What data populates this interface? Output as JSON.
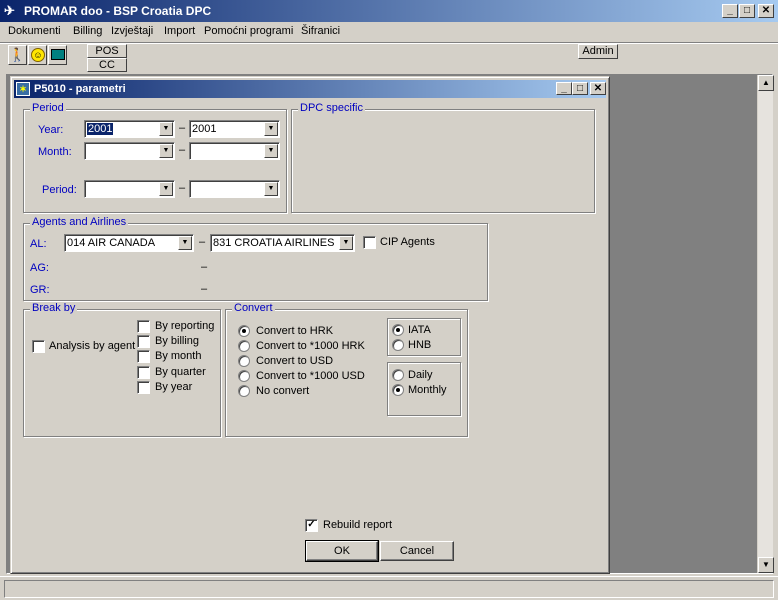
{
  "window": {
    "title": "PROMAR doo - BSP Croatia DPC"
  },
  "menu": [
    "Dokumenti",
    "Billing",
    "Izvještaji",
    "Import",
    "Pomoćni programi",
    "Šifranici"
  ],
  "toolbar": {
    "pos_label": "POS",
    "cc_label": "CC",
    "admin_label": "Admin"
  },
  "dialog": {
    "title": "P5010 - parametri",
    "period": {
      "label": "Period",
      "year_label": "Year:",
      "month_label": "Month:",
      "period_label": "Period:",
      "year_from": "2001",
      "year_to": "2001",
      "month_from": "",
      "month_to": "",
      "period_from": "",
      "period_to": ""
    },
    "dpc": {
      "label": "DPC specific"
    },
    "agents": {
      "label": "Agents and Airlines",
      "al_label": "AL:",
      "ag_label": "AG:",
      "gr_label": "GR:",
      "al_from": "014 AIR CANADA",
      "al_to": "831 CROATIA AIRLINES",
      "cip_label": "CIP Agents",
      "cip_checked": false
    },
    "breakby": {
      "label": "Break by",
      "analysis_label": "Analysis by agent",
      "options": [
        "By reporting",
        "By billing",
        "By month",
        "By quarter",
        "By year"
      ]
    },
    "convert": {
      "label": "Convert",
      "options": [
        "Convert to HRK",
        "Convert to *1000 HRK",
        "Convert to USD",
        "Convert to *1000 USD",
        "No convert"
      ],
      "selected": 0,
      "source_options": [
        "IATA",
        "HNB"
      ],
      "source_selected": 0,
      "freq_options": [
        "Daily",
        "Monthly"
      ],
      "freq_selected": 1
    },
    "rebuild_label": "Rebuild report",
    "rebuild_checked": true,
    "ok_label": "OK",
    "cancel_label": "Cancel"
  },
  "colors": {
    "title_active": "#0a246a",
    "face": "#d4d0c8",
    "group_label": "#0000c0"
  }
}
